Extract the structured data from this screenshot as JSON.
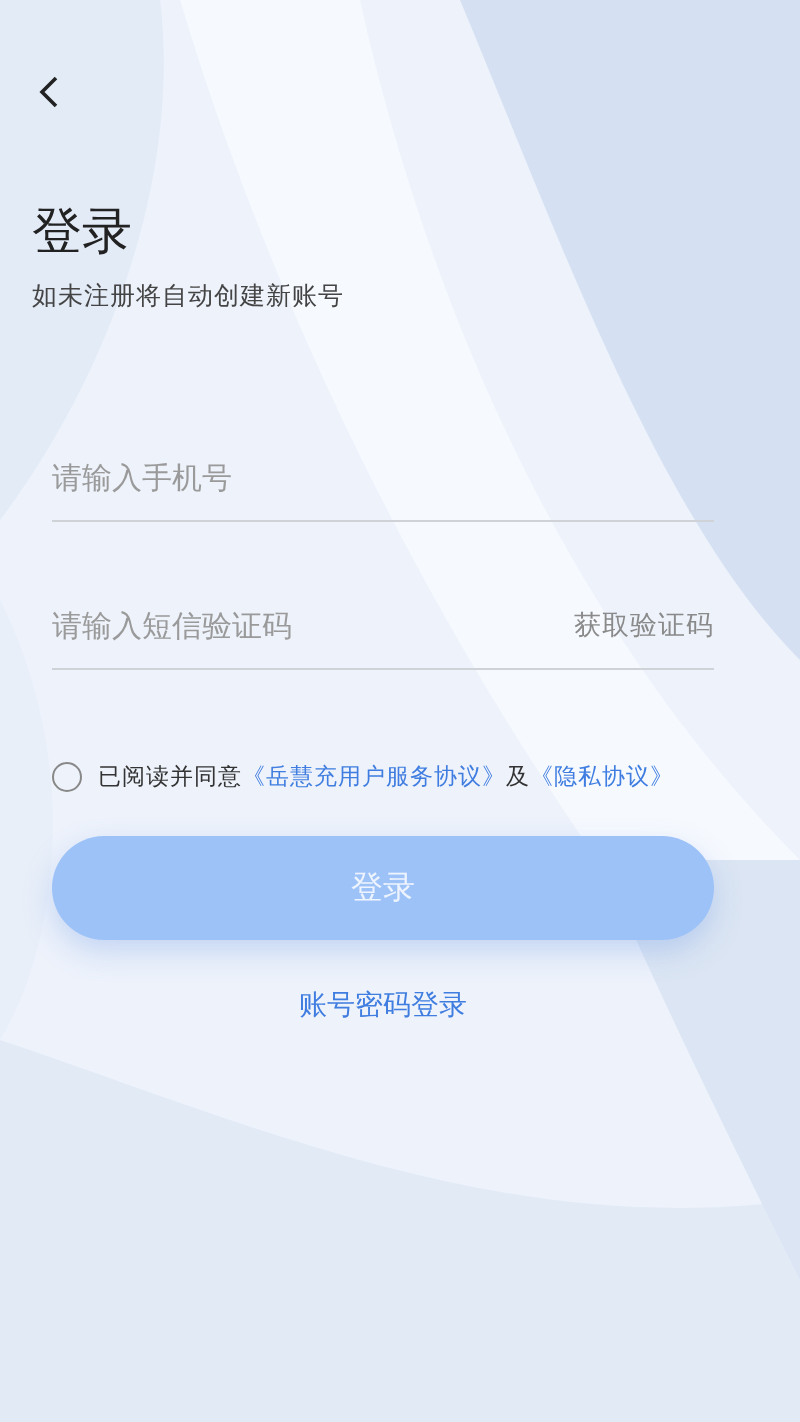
{
  "title": "登录",
  "subtitle": "如未注册将自动创建新账号",
  "fields": [
    {
      "placeholder": "请输入手机号"
    },
    {
      "placeholder": "请输入短信验证码",
      "action": "获取验证码"
    }
  ],
  "agreement": {
    "checked": false,
    "text": "已阅读并同意",
    "links": [
      "《岳慧充用户服务协议》",
      "《隐私协议》"
    ],
    "joiner": "及"
  },
  "login_button": {
    "label": "登录",
    "disabled": true
  },
  "alt_login": "账号密码登录"
}
